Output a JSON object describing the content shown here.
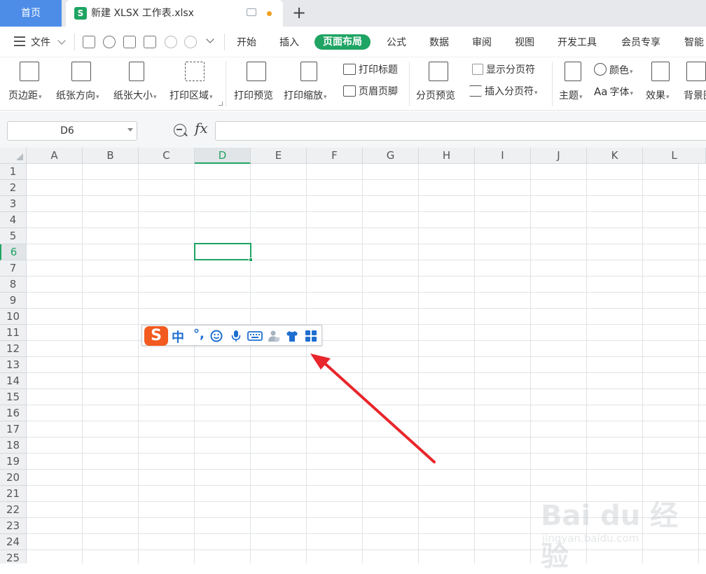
{
  "tabs": {
    "home_label": "首页",
    "file_logo": "S",
    "file_label": "新建 XLSX 工作表.xlsx",
    "add_label": "+"
  },
  "menu": {
    "file_label": "文件",
    "items": [
      "开始",
      "插入",
      "页面布局",
      "公式",
      "数据",
      "审阅",
      "视图",
      "开发工具",
      "会员专享",
      "智能"
    ],
    "active_index": 2
  },
  "ribbon": {
    "margins": "页边距",
    "orientation": "纸张方向",
    "size": "纸张大小",
    "print_area": "打印区域",
    "print_preview": "打印预览",
    "print_scale": "打印缩放",
    "print_titles": "打印标题",
    "header_footer": "页眉页脚",
    "page_break_preview": "分页预览",
    "show_page_breaks": "显示分页符",
    "insert_page_break": "插入分页符",
    "theme": "主题",
    "colors": "颜色",
    "fonts": "字体",
    "fonts_prefix": "Aa",
    "effects": "效果",
    "background": "背景图"
  },
  "formula_bar": {
    "name_box": "D6",
    "fx": "fx",
    "formula": ""
  },
  "sheet": {
    "columns": [
      "A",
      "B",
      "C",
      "D",
      "E",
      "F",
      "G",
      "H",
      "I",
      "J",
      "K",
      "L"
    ],
    "rows": [
      "1",
      "2",
      "3",
      "4",
      "5",
      "6",
      "7",
      "8",
      "9",
      "10",
      "11",
      "12",
      "13",
      "14",
      "15",
      "16",
      "17",
      "18",
      "19",
      "20",
      "21",
      "22",
      "23",
      "24",
      "25"
    ],
    "selected_cell": "D6",
    "selected_column": "D",
    "selected_row": "6"
  },
  "ime": {
    "logo": "S",
    "mode": "中",
    "punctuation": "°,"
  },
  "watermark": {
    "brand": "Bai du 经验",
    "url": "jingyan.baidu.com"
  },
  "colors": {
    "accent_green": "#1fa463",
    "home_tab_blue": "#4d8de8",
    "ime_orange": "#f25a1f",
    "ime_blue": "#1e6fd0",
    "arrow_red": "#e8262b"
  }
}
